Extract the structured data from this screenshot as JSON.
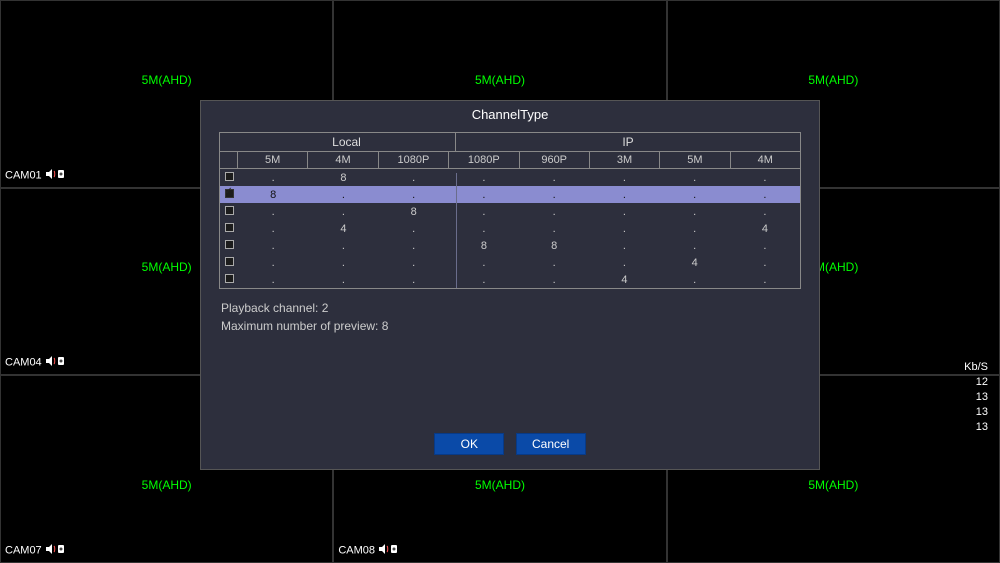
{
  "grid": {
    "res_label": "5M(AHD)",
    "cams": [
      "CAM01",
      "",
      "",
      "CAM04",
      "",
      "",
      "CAM07",
      "CAM08",
      ""
    ]
  },
  "stats": {
    "title": "Kb/S",
    "values": [
      "12",
      "13",
      "13",
      "13"
    ]
  },
  "dialog": {
    "title": "ChannelType",
    "group_local": "Local",
    "group_ip": "IP",
    "cols": [
      "5M",
      "4M",
      "1080P",
      "1080P",
      "960P",
      "3M",
      "5M",
      "4M"
    ],
    "rows": [
      {
        "checked": false,
        "cells": [
          ".",
          "8",
          ".",
          ".",
          ".",
          ".",
          ".",
          "."
        ]
      },
      {
        "checked": true,
        "cells": [
          "8",
          ".",
          ".",
          ".",
          ".",
          ".",
          ".",
          "."
        ]
      },
      {
        "checked": false,
        "cells": [
          ".",
          ".",
          "8",
          ".",
          ".",
          ".",
          ".",
          "."
        ]
      },
      {
        "checked": false,
        "cells": [
          ".",
          "4",
          ".",
          ".",
          ".",
          ".",
          ".",
          "4"
        ]
      },
      {
        "checked": false,
        "cells": [
          ".",
          ".",
          ".",
          "8",
          "8",
          ".",
          ".",
          "."
        ]
      },
      {
        "checked": false,
        "cells": [
          ".",
          ".",
          ".",
          ".",
          ".",
          ".",
          "4",
          "."
        ]
      },
      {
        "checked": false,
        "cells": [
          ".",
          ".",
          ".",
          ".",
          ".",
          "4",
          ".",
          "."
        ]
      }
    ],
    "playback_label": "Playback channel: 2",
    "preview_label": "Maximum number of preview: 8",
    "ok": "OK",
    "cancel": "Cancel"
  }
}
